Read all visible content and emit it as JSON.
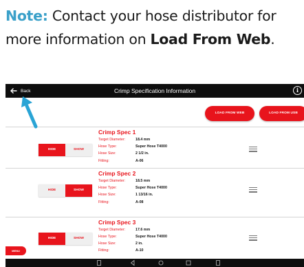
{
  "note": {
    "label": "Note:",
    "text_before": " Contact your hose distributor for more information on ",
    "link_text": "Load From Web",
    "text_after": "."
  },
  "topbar": {
    "back_label": "Back",
    "title": "Crimp Specification Information",
    "info_icon": "i"
  },
  "buttons": {
    "load_from_web": "LOAD FROM WEB",
    "load_from_usb": "LOAD FROM USB"
  },
  "field_labels": {
    "target_diameter": "Target Diameter:",
    "hose_type": "Hose Type:",
    "hose_size": "Hose Size:",
    "fitting": "Fitting:"
  },
  "toggle_labels": {
    "hide": "HIDE",
    "show": "SHOW"
  },
  "specs": [
    {
      "title": "Crimp Spec 1",
      "target_diameter": "18.4 mm",
      "hose_type": "Super Hose T4000",
      "hose_size": "2 1/2 in.",
      "fitting": "A-06",
      "active": "hide"
    },
    {
      "title": "Crimp Spec 2",
      "target_diameter": "18.5 mm",
      "hose_type": "Super Hose T4000",
      "hose_size": "1 13/16 in.",
      "fitting": "A-08",
      "active": "show"
    },
    {
      "title": "Crimp Spec 3",
      "target_diameter": "17.6 mm",
      "hose_type": "Super Hose T4000",
      "hose_size": "2 in.",
      "fitting": "A-10",
      "active": "hide"
    }
  ],
  "menu_button": "MENU",
  "colors": {
    "accent": "#e8141c",
    "note_highlight": "#3aa0c9",
    "bar": "#0e0e0e",
    "pointer": "#2aa4d5"
  }
}
